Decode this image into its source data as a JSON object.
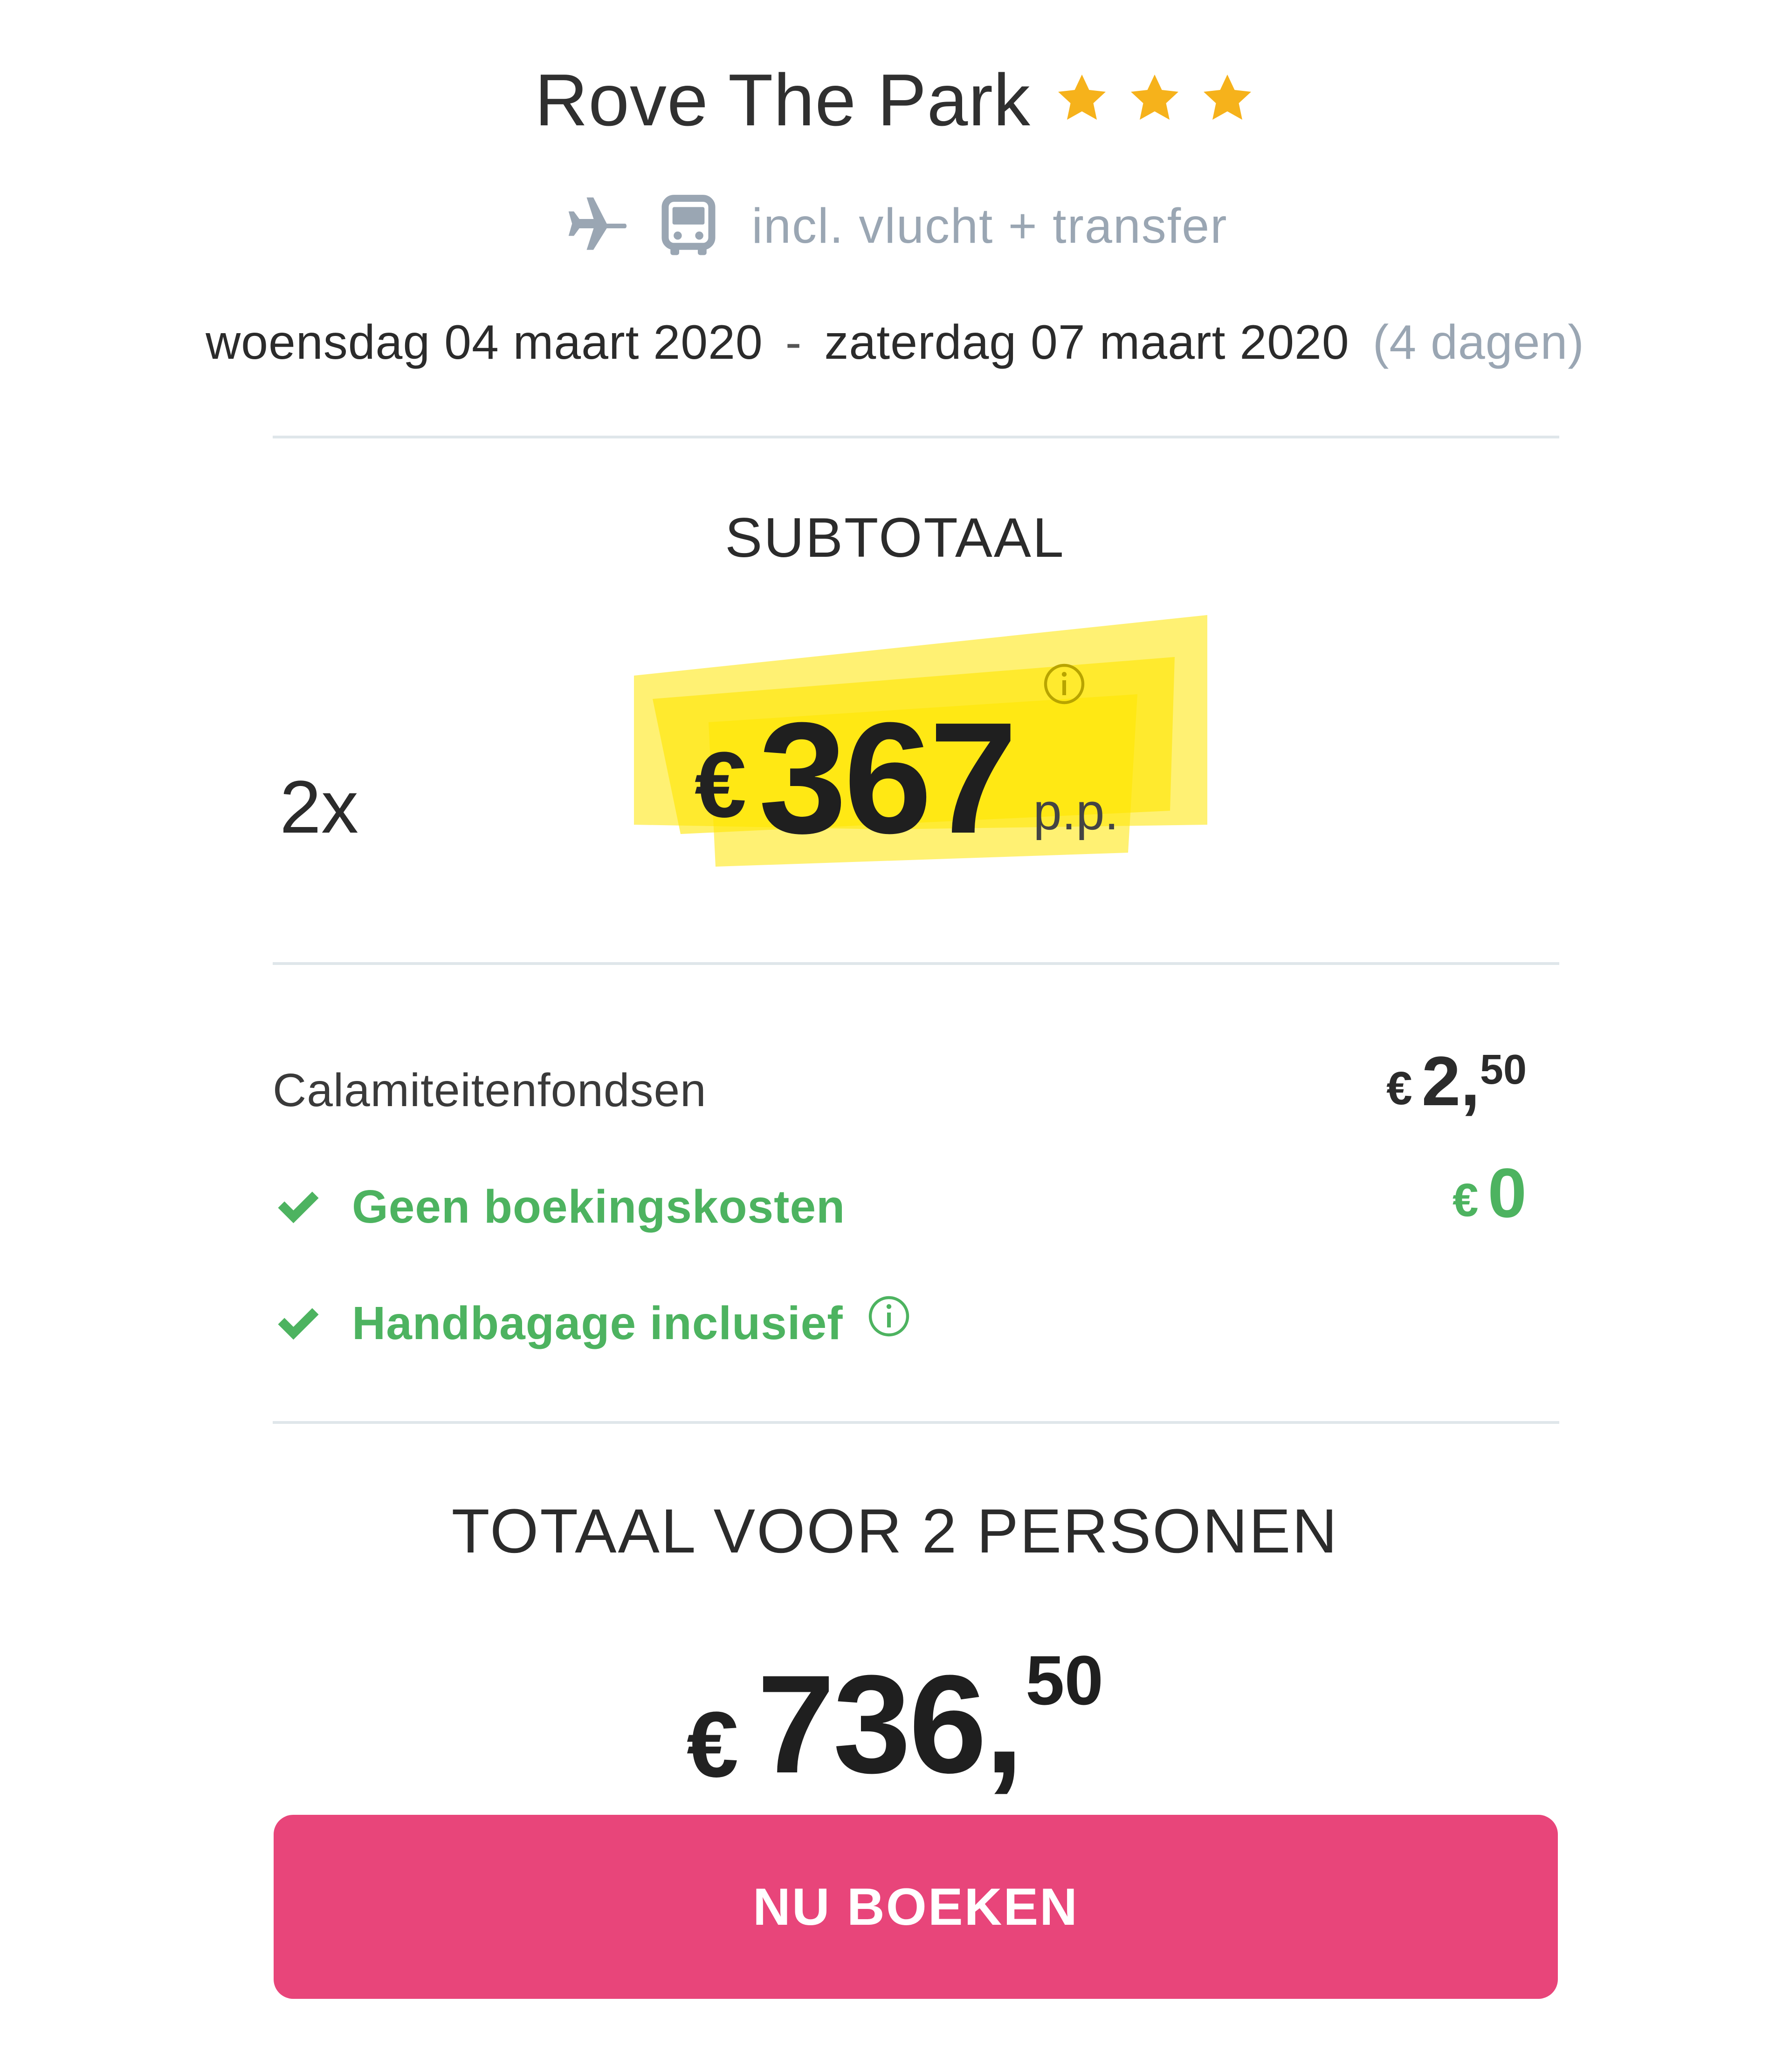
{
  "hotel": {
    "name": "Rove The Park",
    "stars": 3,
    "star_color": "#f6b21b"
  },
  "trip": {
    "includes_text": "incl. vlucht + transfer",
    "includes_icons": [
      "plane-icon",
      "bus-icon"
    ],
    "start_date": "woensdag 04 maart 2020",
    "separator": "-",
    "end_date": "zaterdag 07 maart 2020",
    "duration": "(4 dagen)"
  },
  "subtotal": {
    "label": "SUBTOTAAL",
    "quantity": "2x",
    "currency": "€",
    "amount": "367",
    "per_person": "p.p.",
    "highlight_color": "#ffe600"
  },
  "costs": {
    "calamity_fund": {
      "label": "Calamiteitenfondsen",
      "currency": "€",
      "main": "2,",
      "cents": "50"
    },
    "booking_fee": {
      "label": "Geen boekingskosten",
      "currency": "€",
      "amount": "0"
    },
    "hand_luggage": {
      "label": "Handbagage inclusief"
    },
    "accent_green": "#4db360"
  },
  "total": {
    "label": "TOTAAL VOOR 2 PERSONEN",
    "currency": "€",
    "main": "736,",
    "cents": "50"
  },
  "cta": {
    "label": "NU BOEKEN",
    "color": "#e8457a"
  }
}
